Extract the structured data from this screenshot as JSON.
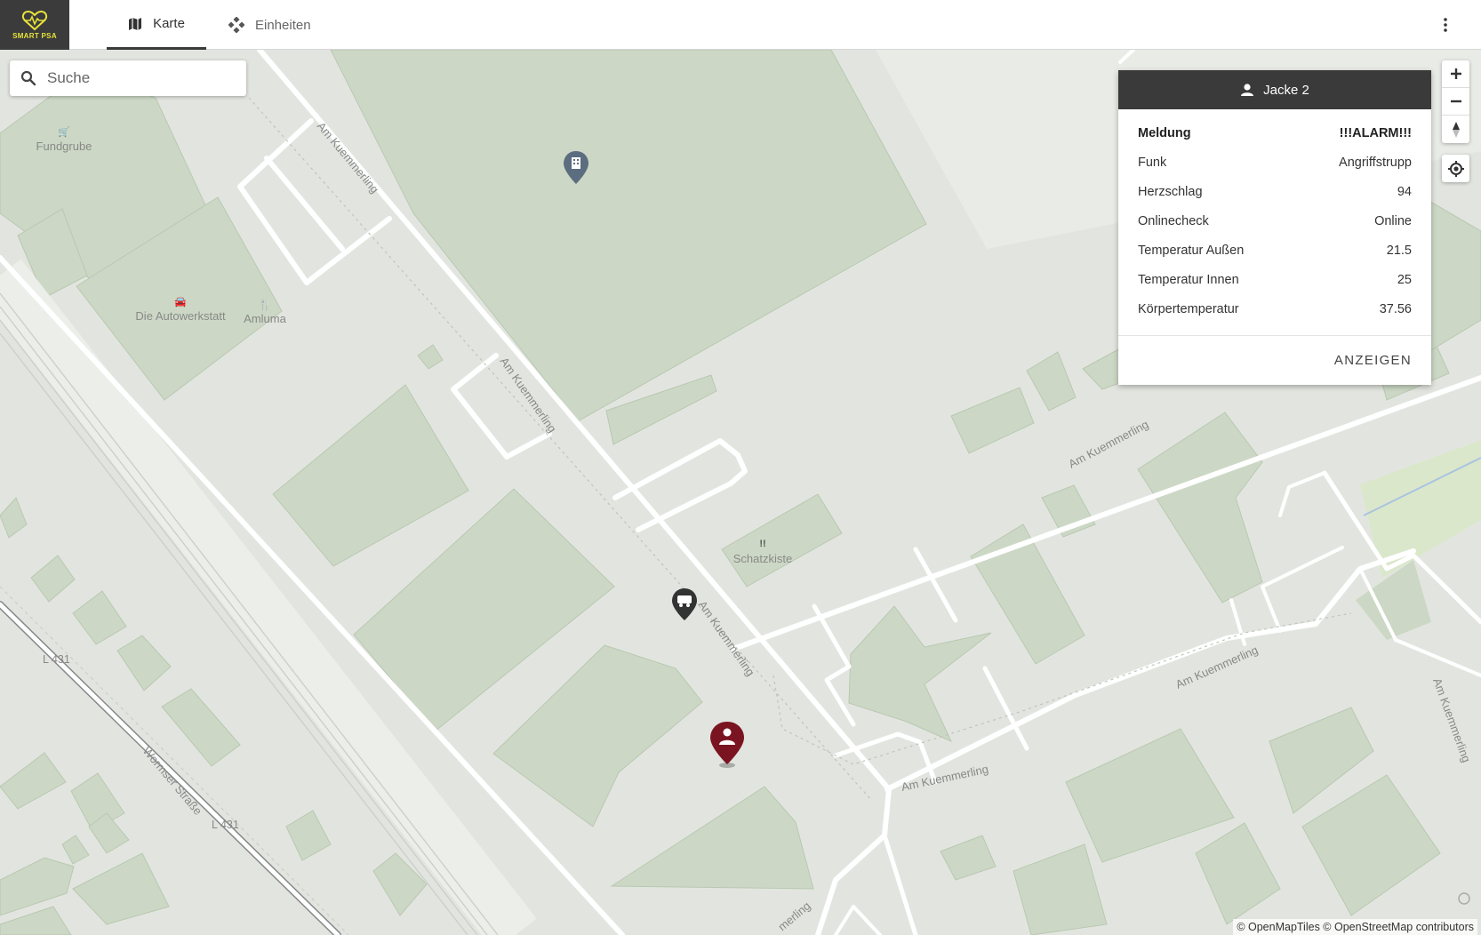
{
  "app": {
    "logo_text": "SMART PSA",
    "tabs": [
      {
        "label": "Karte",
        "icon": "map-icon",
        "active": true
      },
      {
        "label": "Einheiten",
        "icon": "units-icon",
        "active": false
      }
    ],
    "menu_icon": "more-vert-icon"
  },
  "search": {
    "placeholder": "Suche",
    "value": ""
  },
  "map": {
    "streets": {
      "s1": "Am Kuemmerling",
      "s2": "Am Kuemmerling",
      "s3": "Am Kuemmerling",
      "s4": "Am Kuemmerling",
      "s5": "Am Kuemmerling",
      "s6": "Am Kuemmerling",
      "s7": "Am Kuemmerling",
      "s8": "merling",
      "wormser": "Wormser Straße",
      "l431a": "L 431",
      "l431b": "L 431"
    },
    "pois": {
      "fundgrube": "Fundgrube",
      "autowerkstatt": "Die Autowerkstatt",
      "amluma": "Amluma",
      "schatzkiste": "Schatzkiste"
    },
    "attribution": "© OpenMapTiles © OpenStreetMap contributors"
  },
  "popup": {
    "title": "Jacke 2",
    "icon": "person-icon",
    "rows": [
      {
        "label": "Meldung",
        "value": "!!!ALARM!!!"
      },
      {
        "label": "Funk",
        "value": "Angriffstrupp"
      },
      {
        "label": "Herzschlag",
        "value": "94"
      },
      {
        "label": "Onlinecheck",
        "value": "Online"
      },
      {
        "label": "Temperatur Außen",
        "value": "21.5"
      },
      {
        "label": "Temperatur Innen",
        "value": "25"
      },
      {
        "label": "Körpertemperatur",
        "value": "37.56"
      }
    ],
    "action": "ANZEIGEN"
  },
  "controls": {
    "zoom_in": "zoom-in-icon",
    "zoom_out": "zoom-out-icon",
    "compass": "compass-icon",
    "locate": "locate-icon"
  },
  "colors": {
    "header_dark": "#3a3a3a",
    "logo_accent": "#e8e23a",
    "alarm_marker": "#7a1420",
    "building_fill": "#ccd8c5",
    "map_background": "#e2e5df"
  }
}
